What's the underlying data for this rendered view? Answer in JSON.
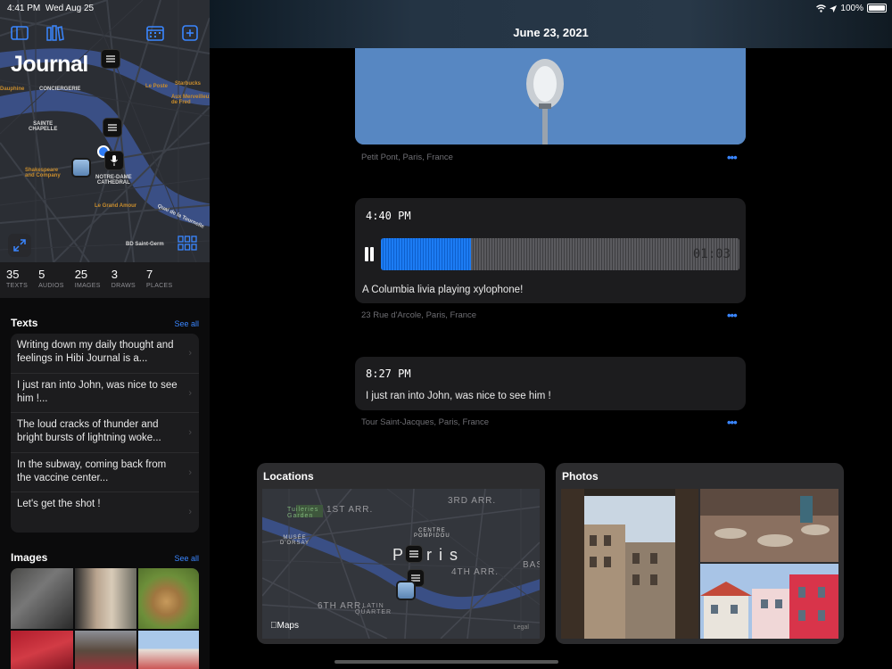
{
  "status_bar": {
    "time": "4:41 PM",
    "date": "Wed Aug 25",
    "battery": "100%"
  },
  "sidebar": {
    "title": "Journal",
    "map_labels": [
      {
        "text": "CONCIERGERIE",
        "kind": "w"
      },
      {
        "text": "SAINTE\nCHAPELLE",
        "kind": "w"
      },
      {
        "text": "NOTRE-DAME\nCATHEDRAL",
        "kind": "w"
      },
      {
        "text": "Shakespeare\nand Company",
        "kind": "o"
      },
      {
        "text": "Le Poste",
        "kind": "o"
      },
      {
        "text": "Aux Merveilleux\nde Fred",
        "kind": "o"
      },
      {
        "text": "Starbucks",
        "kind": "o"
      },
      {
        "text": "Le Grand Amour",
        "kind": "o"
      },
      {
        "text": "BD Saint-Germ",
        "kind": "w"
      },
      {
        "text": "Quai de la Tournelle",
        "kind": "w"
      },
      {
        "text": "Dauphine",
        "kind": "o"
      }
    ],
    "stats": [
      {
        "num": "35",
        "label": "TEXTS"
      },
      {
        "num": "5",
        "label": "AUDIOS"
      },
      {
        "num": "25",
        "label": "IMAGES"
      },
      {
        "num": "3",
        "label": "DRAWS"
      },
      {
        "num": "7",
        "label": "PLACES"
      }
    ],
    "texts_section": {
      "title": "Texts",
      "see_all": "See all",
      "items": [
        "Writing down my daily thought and feelings in Hibi Journal is a...",
        "I just ran into John, was nice to see him !...",
        "The loud cracks of thunder and bright bursts of lightning woke...",
        "In the subway, coming back from the vaccine center...",
        "Let's get the shot !"
      ]
    },
    "images_section": {
      "title": "Images",
      "see_all": "See all"
    }
  },
  "main": {
    "date": "June 23, 2021",
    "entries": [
      {
        "type": "photo",
        "location": "Petit Pont, Paris, France"
      },
      {
        "type": "audio",
        "time": "4:40 PM",
        "duration": "01:03",
        "played_fraction": 0.25,
        "caption": "A Columbia livia playing xylophone!",
        "location": "23 Rue d'Arcole, Paris, France"
      },
      {
        "type": "text",
        "time": "8:27 PM",
        "text": "I just ran into John, was nice to see him !",
        "location": "Tour Saint-Jacques, Paris, France"
      }
    ],
    "more_glyph": "•••",
    "locations_widget": {
      "title": "Locations",
      "map_labels": [
        "1ST ARR.",
        "3RD ARR.",
        "4TH ARR.",
        "6TH ARR.",
        "LATIN\nQUARTER",
        "Paris",
        "CENTRE\nPOMPIDOU",
        "MUSÉE\nD'ORSAY",
        "Tuileries\nGarden",
        "BAS"
      ],
      "maps_brand": "Maps",
      "legal": "Legal"
    },
    "photos_widget": {
      "title": "Photos"
    }
  },
  "colors": {
    "accent": "#3a86ff",
    "audio_played": "#1c7cf4",
    "card_bg": "#1c1c1e"
  }
}
